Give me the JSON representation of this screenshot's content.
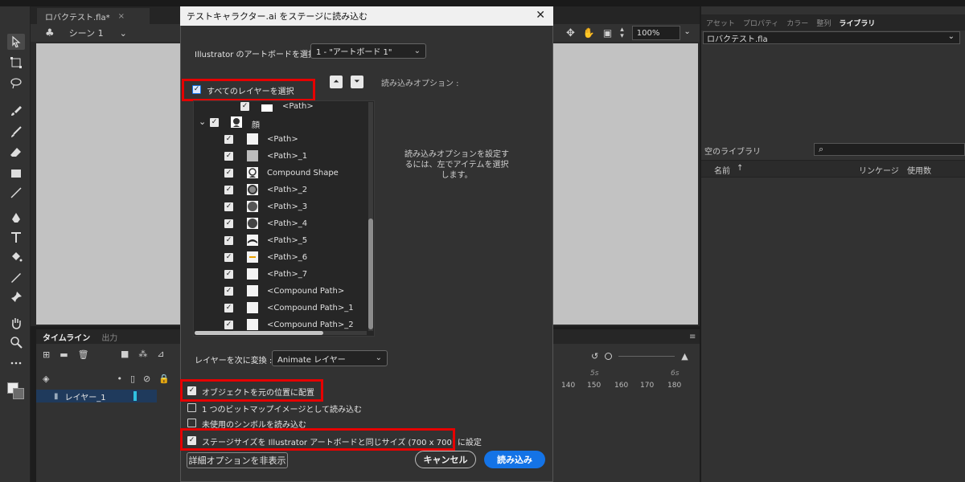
{
  "document": {
    "tab_label": "ロバクテスト.fla*",
    "close_glyph": "×",
    "scene_label": "シーン 1"
  },
  "stage": {
    "zoom": "100%"
  },
  "timeline": {
    "tabs": [
      "タイムライン",
      "出力"
    ],
    "layer_name": "レイヤー_1",
    "frame_numbers": [
      "140",
      "150",
      "160",
      "170",
      "180"
    ],
    "frame_seconds": [
      "5s",
      "6s"
    ]
  },
  "right_panel": {
    "tabs": [
      "アセット",
      "プロパティ",
      "カラー",
      "整列",
      "ライブラリ"
    ],
    "active_tab": "ライブラリ",
    "library_file": "ロバクテスト.fla",
    "library_status": "空のライブラリ",
    "columns": {
      "name": "名前",
      "sort_glyph": "↑",
      "linkage": "リンケージ",
      "use_count": "使用数"
    }
  },
  "dialog": {
    "title": "テストキャラクター.ai をステージに読み込む",
    "close_glyph": "✕",
    "artboard_label": "Illustrator のアートボードを選択 :",
    "artboard_value": "1 - \"アートボード 1\"",
    "select_all_layers": "すべてのレイヤーを選択",
    "import_options_label": "読み込みオプション :",
    "import_options_hint": "読み込みオプションを設定するには、左でアイテムを選択します。",
    "tree": [
      {
        "name": "<Path>",
        "level": 1
      },
      {
        "name": "顔",
        "level": 0,
        "expanded": true
      },
      {
        "name": "<Path>",
        "level": 1
      },
      {
        "name": "<Path>_1",
        "level": 1
      },
      {
        "name": "Compound Shape",
        "level": 1
      },
      {
        "name": "<Path>_2",
        "level": 1
      },
      {
        "name": "<Path>_3",
        "level": 1
      },
      {
        "name": "<Path>_4",
        "level": 1
      },
      {
        "name": "<Path>_5",
        "level": 1
      },
      {
        "name": "<Path>_6",
        "level": 1
      },
      {
        "name": "<Path>_7",
        "level": 1
      },
      {
        "name": "<Compound Path>",
        "level": 1
      },
      {
        "name": "<Compound Path>_1",
        "level": 1
      },
      {
        "name": "<Compound Path>_2",
        "level": 1
      }
    ],
    "convert_label": "レイヤーを次に変換 :",
    "convert_value": "Animate レイヤー",
    "options": [
      {
        "label": "オブジェクトを元の位置に配置",
        "checked": true
      },
      {
        "label": "1 つのビットマップイメージとして読み込む",
        "checked": false
      },
      {
        "label": "未使用のシンボルを読み込む",
        "checked": false
      },
      {
        "label": "ステージサイズを Illustrator アートボードと同じサイズ (700 x 700) に設定",
        "checked": true
      }
    ],
    "advanced_button": "詳細オプションを非表示",
    "cancel_button": "キャンセル",
    "import_button": "読み込み"
  },
  "colors": {
    "highlight": "#e60000",
    "primary_button": "#1473e6",
    "layer_selected": "#1f3a5c"
  }
}
